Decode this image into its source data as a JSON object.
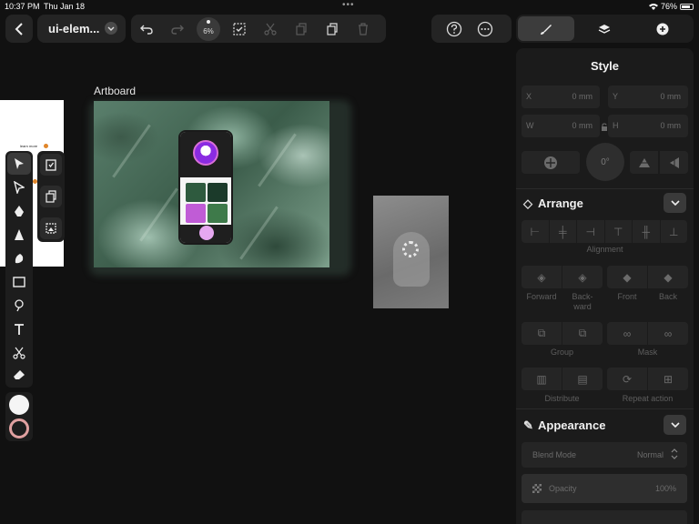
{
  "status": {
    "time": "10:37 PM",
    "date": "Thu Jan 18",
    "dots": "•••",
    "battery": "76%"
  },
  "toolbar": {
    "back_icon": "chevron-left-icon",
    "doc_title": "ui-elem...",
    "zoom": "6%",
    "icons": [
      "undo-icon",
      "redo-icon",
      "zoom-icon",
      "select-check-icon",
      "scissors-icon",
      "copy-icon",
      "paste-icon",
      "trash-icon"
    ],
    "right_icons": [
      "help-icon",
      "more-icon"
    ]
  },
  "canvas": {
    "artboard_label": "Artboard",
    "left_doc_text": "learn more"
  },
  "tools": {
    "items": [
      "pointer-icon",
      "direct-select-icon",
      "pen-icon",
      "vector-brush-icon",
      "pencil-icon",
      "rectangle-icon",
      "shape-builder-icon",
      "text-icon",
      "scissors-icon",
      "eraser-icon"
    ],
    "sub_items": [
      "clipboard-icon",
      "paste-icon",
      "image-icon"
    ],
    "fill_color": "#f5f5f5",
    "stroke_color": "#cccccc"
  },
  "inspector": {
    "tabs": [
      "brush-icon",
      "layers-icon",
      "add-icon"
    ],
    "title": "Style",
    "x_label": "X",
    "x_value": "0 mm",
    "y_label": "Y",
    "y_value": "0 mm",
    "w_label": "W",
    "w_value": "0 mm",
    "h_label": "H",
    "h_value": "0 mm",
    "rotation": "0°",
    "arrange_label": "Arrange",
    "alignment_label": "Alignment",
    "forward": "Forward",
    "backward": "Back-\nward",
    "front": "Front",
    "back": "Back",
    "group": "Group",
    "mask": "Mask",
    "distribute": "Distribute",
    "repeat_action": "Repeat action",
    "appearance_label": "Appearance",
    "blend_mode_label": "Blend Mode",
    "blend_mode_value": "Normal",
    "opacity_label": "Opacity",
    "opacity_value": "100%"
  }
}
